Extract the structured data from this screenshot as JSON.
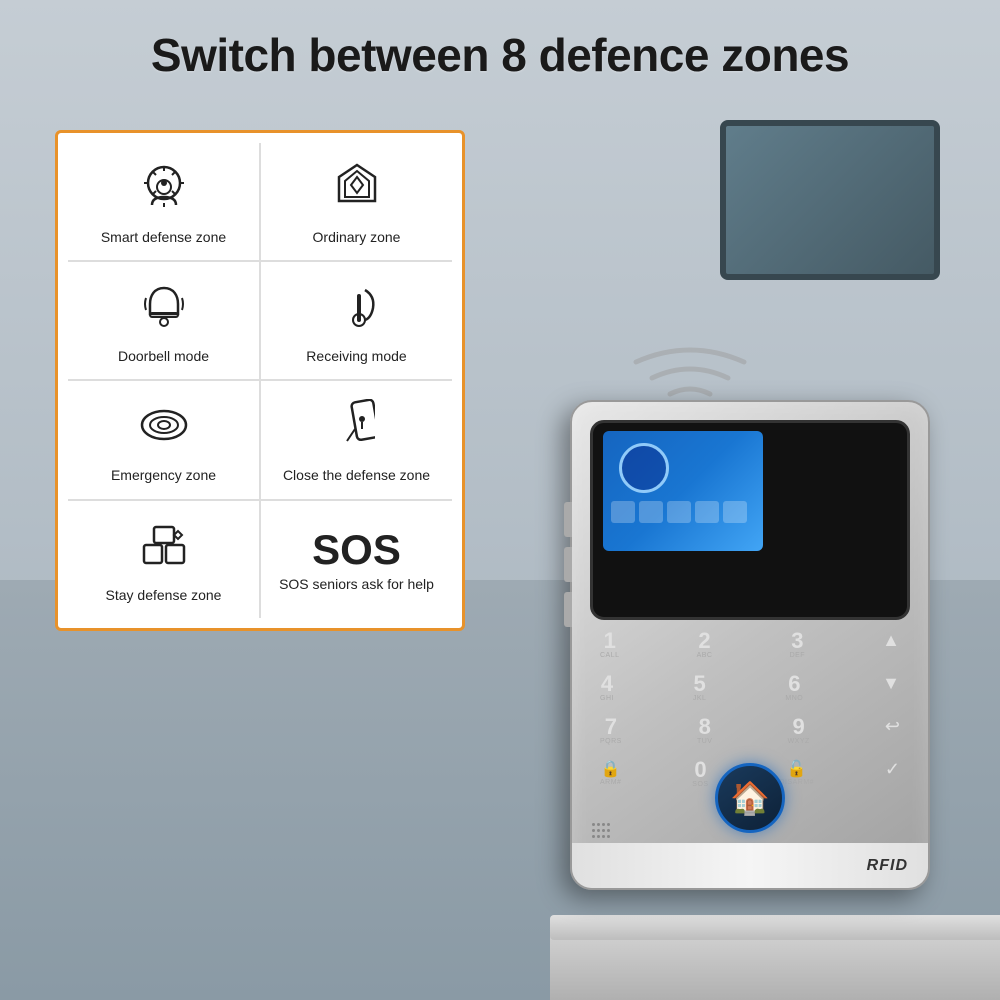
{
  "header": {
    "title": "Switch between 8 defence zones"
  },
  "info_card": {
    "cells": [
      {
        "id": "smart-defense",
        "icon": "🧠",
        "label": "Smart defense zone"
      },
      {
        "id": "ordinary-zone",
        "icon": "🛡",
        "label": "Ordinary zone"
      },
      {
        "id": "doorbell-mode",
        "icon": "🔔",
        "label": "Doorbell mode"
      },
      {
        "id": "receiving-mode",
        "icon": "♪",
        "label": "Receiving mode"
      },
      {
        "id": "emergency-zone",
        "icon": "🔘",
        "label": "Emergency zone"
      },
      {
        "id": "close-defense",
        "icon": "🔑",
        "label": "Close the defense zone"
      },
      {
        "id": "stay-defense",
        "icon": "⬡",
        "label": "Stay defense zone"
      },
      {
        "id": "sos",
        "icon": "SOS",
        "label": "SOS seniors ask for help",
        "isSOS": true
      }
    ]
  },
  "device": {
    "rfid_label": "RFID",
    "keypad": {
      "rows": [
        [
          {
            "number": "1",
            "letters": "CALL"
          },
          {
            "number": "2",
            "letters": "ABC"
          },
          {
            "number": "3",
            "letters": "DEF"
          },
          {
            "number": "↑",
            "letters": ""
          }
        ],
        [
          {
            "number": "4",
            "letters": "GHI"
          },
          {
            "number": "5",
            "letters": "JKL"
          },
          {
            "number": "6",
            "letters": "MNO"
          },
          {
            "number": "↓",
            "letters": ""
          }
        ],
        [
          {
            "number": "7",
            "letters": "PQRS"
          },
          {
            "number": "8",
            "letters": "TUV"
          },
          {
            "number": "9",
            "letters": "WXYZ"
          },
          {
            "number": "↩",
            "letters": ""
          }
        ],
        [
          {
            "number": "🔒",
            "letters": "ARM#"
          },
          {
            "number": "0",
            "letters": ""
          },
          {
            "number": "🔓",
            "letters": "DISARM#"
          },
          {
            "number": "✓",
            "letters": ""
          }
        ]
      ]
    }
  }
}
